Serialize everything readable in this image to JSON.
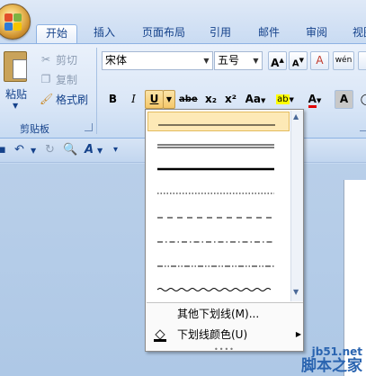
{
  "tabs": [
    "开始",
    "插入",
    "页面布局",
    "引用",
    "邮件",
    "审阅",
    "视图"
  ],
  "clipboard": {
    "paste": "粘贴",
    "cut": "剪切",
    "copy": "复制",
    "format_painter": "格式刷",
    "group_label": "剪贴板"
  },
  "font": {
    "name": "宋体",
    "size": "五号",
    "bold": "B",
    "italic": "I",
    "underline": "U",
    "strikethrough": "abe",
    "subscript": "x₂",
    "superscript": "x²",
    "change_case": "Aa",
    "grow": "A",
    "shrink": "A",
    "clear": "A",
    "phonetic": "wén",
    "highlight": "ab",
    "font_color": "A",
    "char_shading": "A"
  },
  "underline_menu": {
    "styles": [
      "single",
      "double",
      "thick",
      "dotted",
      "dashed",
      "dash-dot",
      "dash-dot-dot",
      "wave"
    ],
    "more_label": "其他下划线(M)...",
    "color_label": "下划线颜色(U)"
  },
  "watermark": {
    "line1": "jb51.net",
    "line2": "脚本之家"
  },
  "colors": {
    "accent": "#15428b",
    "highlight_yellow": "#ffff00",
    "font_red": "#e00000"
  }
}
